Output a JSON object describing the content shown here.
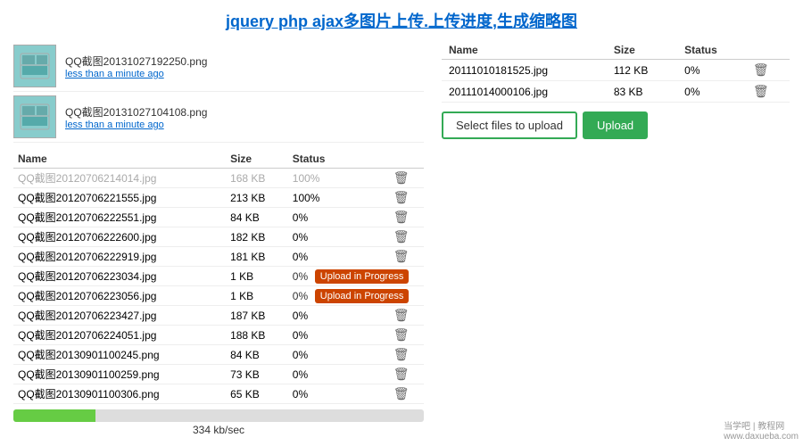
{
  "title": "jquery php ajax多图片上传.上传进度,生成缩略图",
  "uploaded_items": [
    {
      "name": "QQ截图20131027192250.png",
      "time": "less than a minute ago"
    },
    {
      "name": "QQ截图20131027104108.png",
      "time": "less than a minute ago"
    }
  ],
  "left_table": {
    "headers": [
      "Name",
      "Size",
      "Status"
    ],
    "rows": [
      {
        "name": "QQ截图20120706214014.jpg",
        "size": "168 KB",
        "status": "100%",
        "completed": true
      },
      {
        "name": "QQ截图20120706221555.jpg",
        "size": "213 KB",
        "status": "100%",
        "completed": false
      },
      {
        "name": "QQ截图20120706222551.jpg",
        "size": "84 KB",
        "status": "0%",
        "completed": false
      },
      {
        "name": "QQ截图20120706222600.jpg",
        "size": "182 KB",
        "status": "0%",
        "completed": false
      },
      {
        "name": "QQ截图20120706222919.jpg",
        "size": "181 KB",
        "status": "0%",
        "completed": false
      },
      {
        "name": "QQ截图20120706223034.jpg",
        "size": "1 KB",
        "status": "0%",
        "uploading": true
      },
      {
        "name": "QQ截图20120706223056.jpg",
        "size": "1 KB",
        "status": "0%",
        "uploading": true
      },
      {
        "name": "QQ截图20120706223427.jpg",
        "size": "187 KB",
        "status": "0%",
        "completed": false
      },
      {
        "name": "QQ截图20120706224051.jpg",
        "size": "188 KB",
        "status": "0%",
        "completed": false
      },
      {
        "name": "QQ截图20130901100245.png",
        "size": "84 KB",
        "status": "0%",
        "completed": false
      },
      {
        "name": "QQ截图20130901100259.png",
        "size": "73 KB",
        "status": "0%",
        "completed": false
      },
      {
        "name": "QQ截图20130901100306.png",
        "size": "65 KB",
        "status": "0%",
        "completed": false
      }
    ]
  },
  "progress": {
    "fill_percent": 20,
    "speed": "334 kb/sec"
  },
  "right_table": {
    "headers": [
      "Name",
      "Size",
      "Status"
    ],
    "rows": [
      {
        "name": "20111010181525.jpg",
        "size": "112 KB",
        "status": "0%"
      },
      {
        "name": "20111014000106.jpg",
        "size": "83 KB",
        "status": "0%"
      }
    ]
  },
  "buttons": {
    "select_label": "Select files to upload",
    "upload_label": "Upload"
  },
  "upload_in_progress_label": "Upload in Progress",
  "watermark": "当学吧 | 教程网\nwww.daxueba.com"
}
